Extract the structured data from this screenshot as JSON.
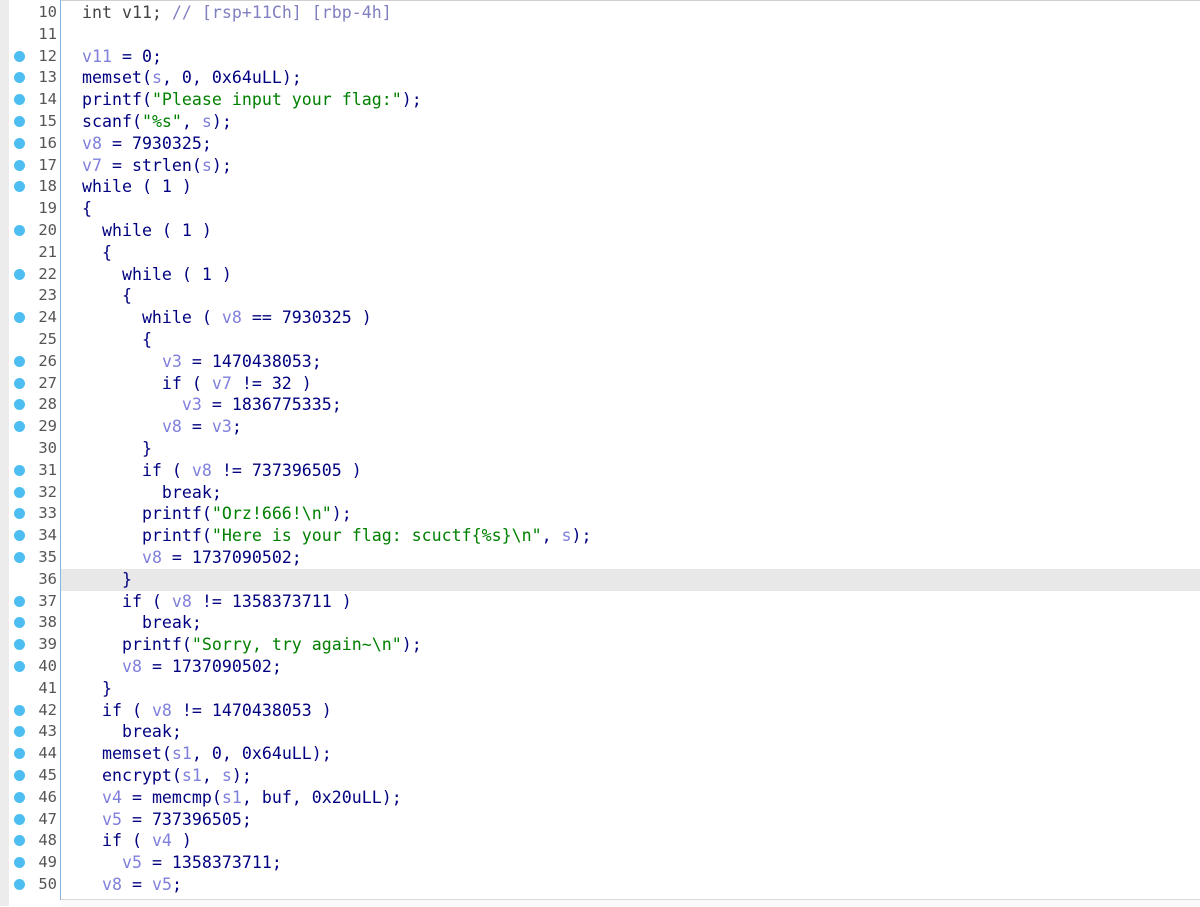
{
  "colors": {
    "keyword": "#000080",
    "variable": "#7f7fdc",
    "string": "#008000",
    "comment": "#8080c0",
    "breakpoint_dot": "#4dbdf2",
    "highlight": "#e8e8e8"
  },
  "highlighted_line": 36,
  "lines": [
    {
      "num": "10",
      "dot": false,
      "segs": [
        [
          "d",
          "int v11; "
        ],
        [
          "c",
          "// [rsp+11Ch] [rbp-4h]"
        ]
      ]
    },
    {
      "num": "11",
      "dot": false,
      "segs": []
    },
    {
      "num": "12",
      "dot": true,
      "segs": [
        [
          "v",
          "v11"
        ],
        [
          "k",
          " = 0;"
        ]
      ]
    },
    {
      "num": "13",
      "dot": true,
      "segs": [
        [
          "k",
          "memset("
        ],
        [
          "v",
          "s"
        ],
        [
          "k",
          ", 0, 0x64uLL);"
        ]
      ]
    },
    {
      "num": "14",
      "dot": true,
      "segs": [
        [
          "k",
          "printf("
        ],
        [
          "s",
          "\"Please input your flag:\""
        ],
        [
          "k",
          ");"
        ]
      ]
    },
    {
      "num": "15",
      "dot": true,
      "segs": [
        [
          "k",
          "scanf("
        ],
        [
          "s",
          "\"%s\""
        ],
        [
          "k",
          ", "
        ],
        [
          "v",
          "s"
        ],
        [
          "k",
          ");"
        ]
      ]
    },
    {
      "num": "16",
      "dot": true,
      "segs": [
        [
          "v",
          "v8"
        ],
        [
          "k",
          " = 7930325;"
        ]
      ]
    },
    {
      "num": "17",
      "dot": true,
      "segs": [
        [
          "v",
          "v7"
        ],
        [
          "k",
          " = strlen("
        ],
        [
          "v",
          "s"
        ],
        [
          "k",
          ");"
        ]
      ]
    },
    {
      "num": "18",
      "dot": true,
      "segs": [
        [
          "k",
          "while ( 1 )"
        ]
      ]
    },
    {
      "num": "19",
      "dot": false,
      "segs": [
        [
          "k",
          "{"
        ]
      ]
    },
    {
      "num": "20",
      "dot": true,
      "segs": [
        [
          "k",
          "  while ( 1 )"
        ]
      ]
    },
    {
      "num": "21",
      "dot": false,
      "segs": [
        [
          "k",
          "  {"
        ]
      ]
    },
    {
      "num": "22",
      "dot": true,
      "segs": [
        [
          "k",
          "    while ( 1 )"
        ]
      ]
    },
    {
      "num": "23",
      "dot": false,
      "segs": [
        [
          "k",
          "    {"
        ]
      ]
    },
    {
      "num": "24",
      "dot": true,
      "segs": [
        [
          "k",
          "      while ( "
        ],
        [
          "v",
          "v8"
        ],
        [
          "k",
          " == 7930325 )"
        ]
      ]
    },
    {
      "num": "25",
      "dot": false,
      "segs": [
        [
          "k",
          "      {"
        ]
      ]
    },
    {
      "num": "26",
      "dot": true,
      "segs": [
        [
          "k",
          "        "
        ],
        [
          "v",
          "v3"
        ],
        [
          "k",
          " = 1470438053;"
        ]
      ]
    },
    {
      "num": "27",
      "dot": true,
      "segs": [
        [
          "k",
          "        if ( "
        ],
        [
          "v",
          "v7"
        ],
        [
          "k",
          " != 32 )"
        ]
      ]
    },
    {
      "num": "28",
      "dot": true,
      "segs": [
        [
          "k",
          "          "
        ],
        [
          "v",
          "v3"
        ],
        [
          "k",
          " = 1836775335;"
        ]
      ]
    },
    {
      "num": "29",
      "dot": true,
      "segs": [
        [
          "k",
          "        "
        ],
        [
          "v",
          "v8"
        ],
        [
          "k",
          " = "
        ],
        [
          "v",
          "v3"
        ],
        [
          "k",
          ";"
        ]
      ]
    },
    {
      "num": "30",
      "dot": false,
      "segs": [
        [
          "k",
          "      }"
        ]
      ]
    },
    {
      "num": "31",
      "dot": true,
      "segs": [
        [
          "k",
          "      if ( "
        ],
        [
          "v",
          "v8"
        ],
        [
          "k",
          " != 737396505 )"
        ]
      ]
    },
    {
      "num": "32",
      "dot": true,
      "segs": [
        [
          "k",
          "        break;"
        ]
      ]
    },
    {
      "num": "33",
      "dot": true,
      "segs": [
        [
          "k",
          "      printf("
        ],
        [
          "s",
          "\"Orz!666!\\n\""
        ],
        [
          "k",
          ");"
        ]
      ]
    },
    {
      "num": "34",
      "dot": true,
      "segs": [
        [
          "k",
          "      printf("
        ],
        [
          "s",
          "\"Here is your flag: scuctf{%s}\\n\""
        ],
        [
          "k",
          ", "
        ],
        [
          "v",
          "s"
        ],
        [
          "k",
          ");"
        ]
      ]
    },
    {
      "num": "35",
      "dot": true,
      "segs": [
        [
          "k",
          "      "
        ],
        [
          "v",
          "v8"
        ],
        [
          "k",
          " = 1737090502;"
        ]
      ]
    },
    {
      "num": "36",
      "dot": false,
      "segs": [
        [
          "k",
          "    }"
        ]
      ]
    },
    {
      "num": "37",
      "dot": true,
      "segs": [
        [
          "k",
          "    if ( "
        ],
        [
          "v",
          "v8"
        ],
        [
          "k",
          " != 1358373711 )"
        ]
      ]
    },
    {
      "num": "38",
      "dot": true,
      "segs": [
        [
          "k",
          "      break;"
        ]
      ]
    },
    {
      "num": "39",
      "dot": true,
      "segs": [
        [
          "k",
          "    printf("
        ],
        [
          "s",
          "\"Sorry, try again~\\n\""
        ],
        [
          "k",
          ");"
        ]
      ]
    },
    {
      "num": "40",
      "dot": true,
      "segs": [
        [
          "k",
          "    "
        ],
        [
          "v",
          "v8"
        ],
        [
          "k",
          " = 1737090502;"
        ]
      ]
    },
    {
      "num": "41",
      "dot": false,
      "segs": [
        [
          "k",
          "  }"
        ]
      ]
    },
    {
      "num": "42",
      "dot": true,
      "segs": [
        [
          "k",
          "  if ( "
        ],
        [
          "v",
          "v8"
        ],
        [
          "k",
          " != 1470438053 )"
        ]
      ]
    },
    {
      "num": "43",
      "dot": true,
      "segs": [
        [
          "k",
          "    break;"
        ]
      ]
    },
    {
      "num": "44",
      "dot": true,
      "segs": [
        [
          "k",
          "  memset("
        ],
        [
          "v",
          "s1"
        ],
        [
          "k",
          ", 0, 0x64uLL);"
        ]
      ]
    },
    {
      "num": "45",
      "dot": true,
      "segs": [
        [
          "k",
          "  encrypt("
        ],
        [
          "v",
          "s1"
        ],
        [
          "k",
          ", "
        ],
        [
          "v",
          "s"
        ],
        [
          "k",
          ");"
        ]
      ]
    },
    {
      "num": "46",
      "dot": true,
      "segs": [
        [
          "k",
          "  "
        ],
        [
          "v",
          "v4"
        ],
        [
          "k",
          " = memcmp("
        ],
        [
          "v",
          "s1"
        ],
        [
          "k",
          ", buf, 0x20uLL);"
        ]
      ]
    },
    {
      "num": "47",
      "dot": true,
      "segs": [
        [
          "k",
          "  "
        ],
        [
          "v",
          "v5"
        ],
        [
          "k",
          " = 737396505;"
        ]
      ]
    },
    {
      "num": "48",
      "dot": true,
      "segs": [
        [
          "k",
          "  if ( "
        ],
        [
          "v",
          "v4"
        ],
        [
          "k",
          " )"
        ]
      ]
    },
    {
      "num": "49",
      "dot": true,
      "segs": [
        [
          "k",
          "    "
        ],
        [
          "v",
          "v5"
        ],
        [
          "k",
          " = 1358373711;"
        ]
      ]
    },
    {
      "num": "50",
      "dot": true,
      "segs": [
        [
          "k",
          "  "
        ],
        [
          "v",
          "v8"
        ],
        [
          "k",
          " = "
        ],
        [
          "v",
          "v5"
        ],
        [
          "k",
          ";"
        ]
      ]
    }
  ]
}
